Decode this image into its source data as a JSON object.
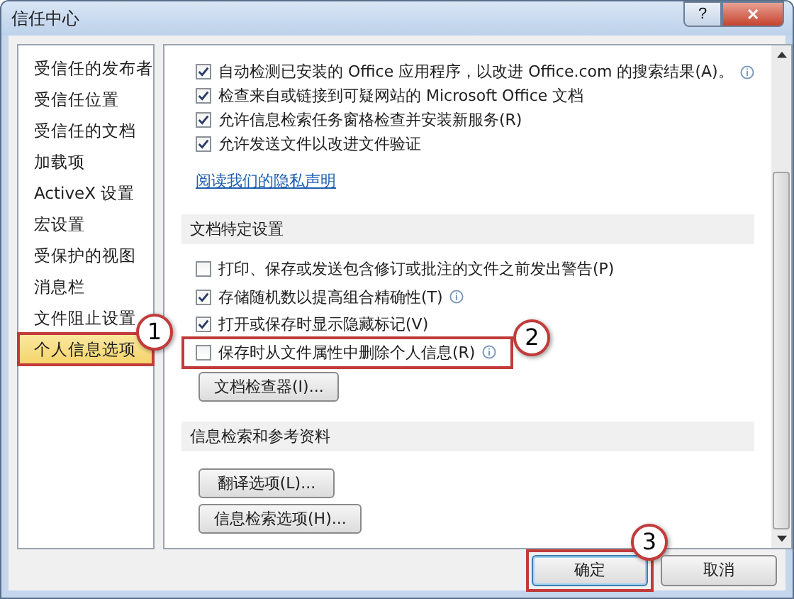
{
  "window": {
    "title": "信任中心",
    "help_button": "?",
    "close_button": "✕"
  },
  "sidebar": {
    "items": [
      {
        "label": "受信任的发布者",
        "selected": false
      },
      {
        "label": "受信任位置",
        "selected": false
      },
      {
        "label": "受信任的文档",
        "selected": false
      },
      {
        "label": "加载项",
        "selected": false
      },
      {
        "label": "ActiveX 设置",
        "selected": false
      },
      {
        "label": "宏设置",
        "selected": false
      },
      {
        "label": "受保护的视图",
        "selected": false
      },
      {
        "label": "消息栏",
        "selected": false
      },
      {
        "label": "文件阻止设置",
        "selected": false
      },
      {
        "label": "个人信息选项",
        "selected": true,
        "callout": "1"
      }
    ]
  },
  "content": {
    "top_options": [
      {
        "label": "自动检测已安装的 Office 应用程序，以改进 Office.com 的搜索结果(A)。",
        "checked": true,
        "info": true
      },
      {
        "label": "检查来自或链接到可疑网站的 Microsoft Office 文档",
        "checked": true,
        "info": false
      },
      {
        "label": "允许信息检索任务窗格检查并安装新服务(R)",
        "checked": true,
        "info": false
      },
      {
        "label": "允许发送文件以改进文件验证",
        "checked": true,
        "info": false
      }
    ],
    "privacy_link": "阅读我们的隐私声明",
    "sections": [
      {
        "title": "文档特定设置",
        "options": [
          {
            "label": "打印、保存或发送包含修订或批注的文件之前发出警告(P)",
            "checked": false,
            "info": false
          },
          {
            "label": "存储随机数以提高组合精确性(T)",
            "checked": true,
            "info": true
          },
          {
            "label": "打开或保存时显示隐藏标记(V)",
            "checked": true,
            "info": false
          },
          {
            "label": "保存时从文件属性中删除个人信息(R)",
            "checked": false,
            "info": true,
            "callout": "2"
          }
        ],
        "buttons": [
          "文档检查器(I)..."
        ]
      },
      {
        "title": "信息检索和参考资料",
        "buttons": [
          "翻译选项(L)...",
          "信息检索选项(H)..."
        ]
      }
    ]
  },
  "footer_buttons": [
    {
      "label": "确定",
      "default": true,
      "callout": "3"
    },
    {
      "label": "取消",
      "default": false
    }
  ]
}
